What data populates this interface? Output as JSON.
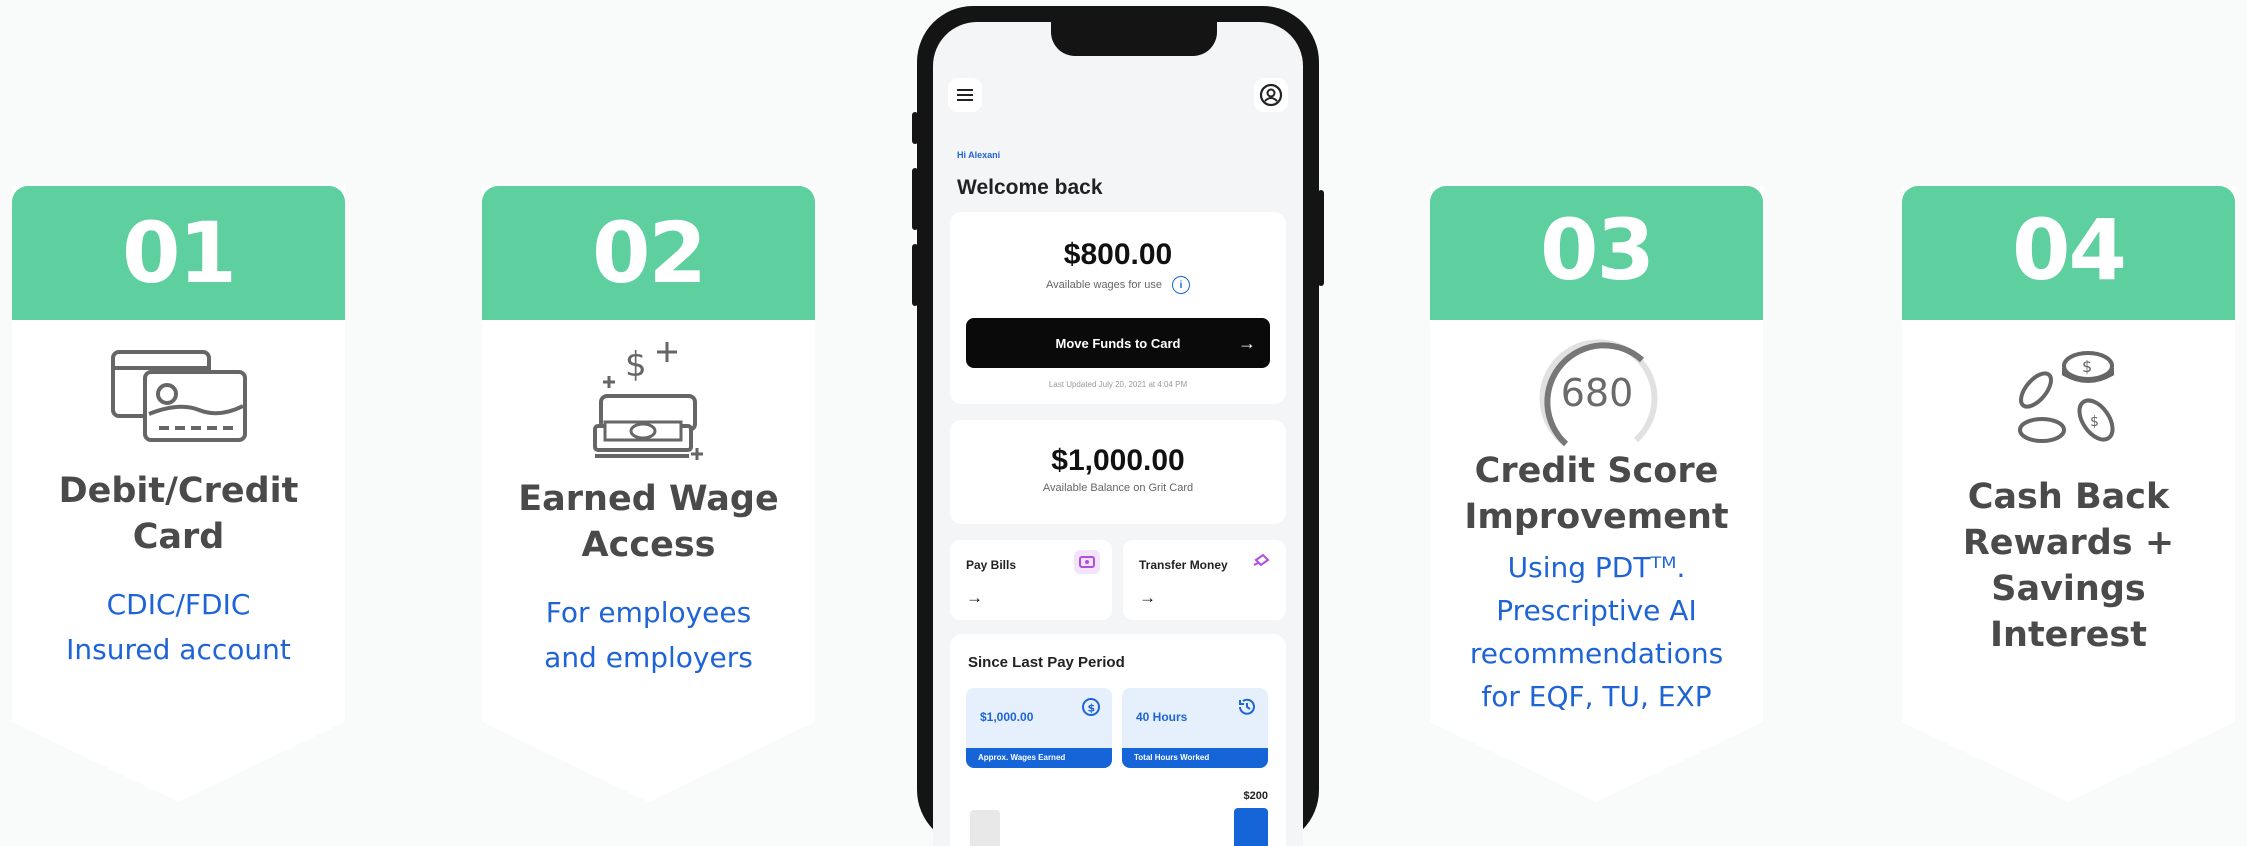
{
  "features": [
    {
      "number": "01",
      "icon": "credit-cards-icon",
      "title_lines": [
        "Debit/Credit",
        "Card"
      ],
      "desc_lines": [
        "CDIC/FDIC",
        "Insured account"
      ]
    },
    {
      "number": "02",
      "icon": "money-dispense-icon",
      "title_lines": [
        "Earned Wage",
        "Access"
      ],
      "desc_lines": [
        "For employees",
        "and employers"
      ]
    },
    {
      "number": "03",
      "icon": "credit-gauge-icon",
      "gauge_value": "680",
      "title_lines": [
        "Credit Score",
        "Improvement"
      ],
      "desc_lines": [
        "Using PDTᵀᴹ.",
        "Prescriptive AI",
        "recommendations",
        "for EQF, TU, EXP"
      ]
    },
    {
      "number": "04",
      "icon": "coins-icon",
      "title_lines": [
        "Cash Back",
        "Rewards +",
        "Savings",
        "Interest"
      ],
      "desc_lines": []
    }
  ],
  "phone": {
    "greeting": "Hi Alexani",
    "welcome": "Welcome back",
    "wages_amount": "$800.00",
    "wages_caption": "Available wages for use",
    "move_button": "Move Funds to Card",
    "last_updated": "Last Updated July 20, 2021 at 4:04 PM",
    "balance_amount": "$1,000.00",
    "balance_caption": "Available Balance on Grit Card",
    "pay_bills": "Pay Bills",
    "transfer_money": "Transfer Money",
    "since_title": "Since Last Pay Period",
    "wages_earned_value": "$1,000.00",
    "wages_earned_label": "Approx. Wages Earned",
    "hours_value": "40 Hours",
    "hours_label": "Total Hours Worked",
    "chart_max": "$200"
  },
  "colors": {
    "accent_green": "#5ecf9f",
    "link_blue": "#1f64d6",
    "text_dark": "#4a4a4a"
  }
}
